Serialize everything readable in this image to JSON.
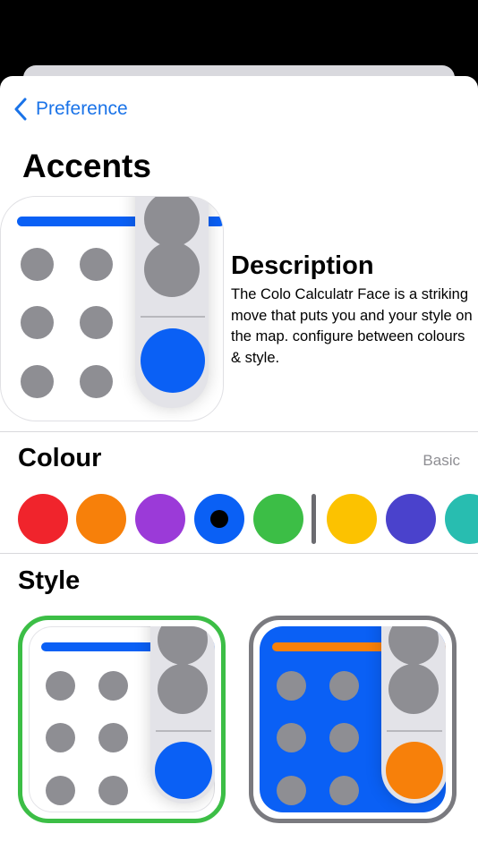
{
  "nav": {
    "back_label": "Preference"
  },
  "page": {
    "title": "Accents"
  },
  "preview": {
    "accent": "#0a60f5"
  },
  "description": {
    "heading": "Description",
    "body": "The Colo Calculatr Face is a striking move that puts you and your style on the map. configure between colours & style."
  },
  "colour": {
    "title": "Colour",
    "mode": "Basic",
    "swatches": [
      {
        "name": "red",
        "color": "#f0242c",
        "selected": false
      },
      {
        "name": "orange",
        "color": "#f7800a",
        "selected": false
      },
      {
        "name": "purple",
        "color": "#9b3ad8",
        "selected": false
      },
      {
        "name": "blue",
        "color": "#0a60f5",
        "selected": true
      },
      {
        "name": "green",
        "color": "#3cbe46",
        "selected": false
      },
      {
        "name": "yellow",
        "color": "#fcc200",
        "selected": false
      },
      {
        "name": "indigo",
        "color": "#4a42cc",
        "selected": false
      },
      {
        "name": "teal",
        "color": "#28bdb0",
        "selected": false
      }
    ]
  },
  "style": {
    "title": "Style",
    "options": [
      {
        "name": "light",
        "background": "#ffffff",
        "bar": "#0a60f5",
        "accent": "#0a60f5",
        "border": "#3cbe46",
        "selected": true
      },
      {
        "name": "filled",
        "background": "#0a60f5",
        "bar": "#f7800a",
        "accent": "#f7800a",
        "border": "#7a7a7f",
        "selected": false
      }
    ]
  }
}
